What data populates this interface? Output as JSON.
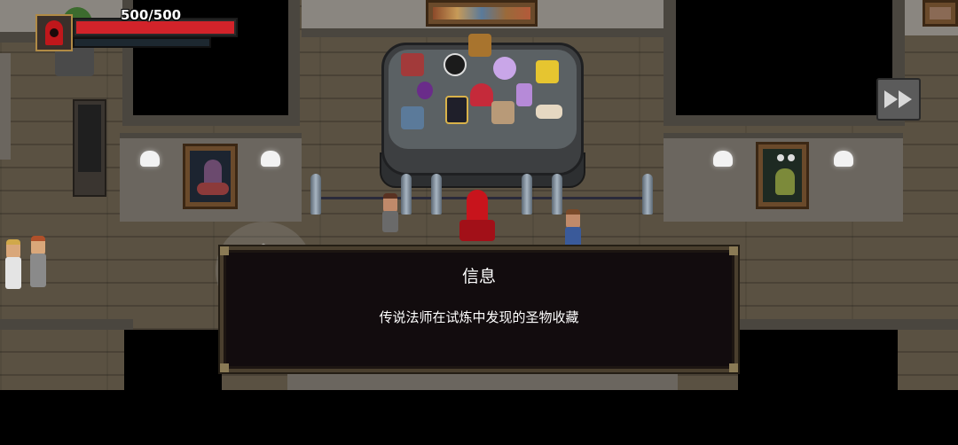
{
  "hud": {
    "hp_text": "500/500",
    "hp_current": 500,
    "hp_max": 500,
    "portrait_icon": "red-hood-mage-icon"
  },
  "controls": {
    "fast_forward_icon": "fast-forward-icon",
    "joystick_icon": "chevron-up-icon"
  },
  "dialog": {
    "title": "信息",
    "message": "传说法师在试炼中发现的圣物收藏"
  },
  "colors": {
    "hp_bar": "#d2232a",
    "dialog_bg": "#120c0e",
    "dialog_border": "#4a3f2e",
    "floor": "#5a5142"
  }
}
